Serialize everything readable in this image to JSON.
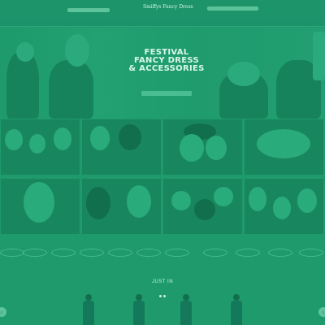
{
  "header": {
    "top_text": "",
    "logo": "Smiffys Fancy Dress",
    "logo_sub": ""
  },
  "nav": {
    "items": [
      "",
      "",
      "",
      "",
      "",
      "",
      "",
      "",
      ""
    ]
  },
  "hero": {
    "title_line1": "FESTIVAL",
    "title_line2": "FANCY DRESS",
    "title_line3": "& ACCESSORIES",
    "subtitle": "",
    "button": ""
  },
  "categories": [
    {
      "label": ""
    },
    {
      "label": ""
    },
    {
      "label": ""
    },
    {
      "label": ""
    },
    {
      "label": ""
    },
    {
      "label": ""
    },
    {
      "label": ""
    },
    {
      "label": ""
    }
  ],
  "brands": {
    "title": "",
    "items": [
      "",
      "",
      "",
      "",
      "",
      "",
      "",
      "",
      "",
      "",
      ""
    ]
  },
  "just_in": {
    "title": "JUST IN"
  },
  "colors": {
    "overlay": "#1f9a6c",
    "accent": "#5cc39b"
  }
}
